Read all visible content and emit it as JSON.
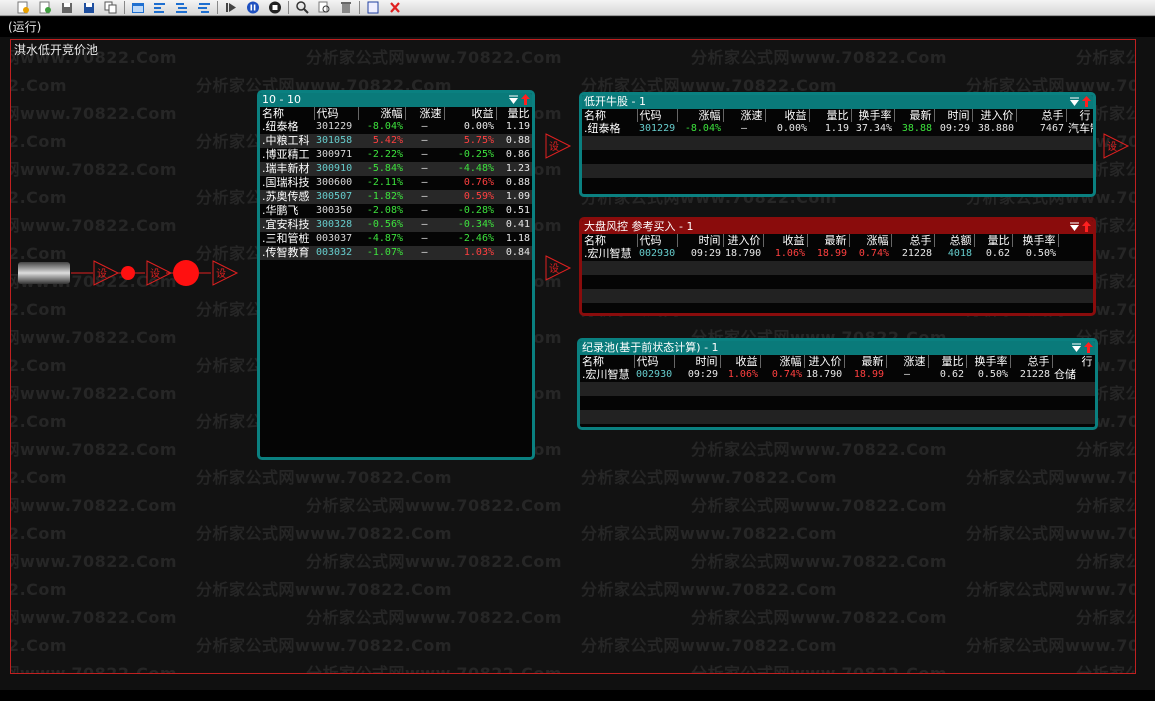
{
  "toolbar": {
    "buttons": [
      "new-icon",
      "open-icon",
      "save-icon",
      "save-as-icon",
      "copy-icon",
      "window-icon",
      "align-left-icon",
      "align-center-icon",
      "align-right-icon",
      "step-icon",
      "pause-icon",
      "stop-icon",
      "search-icon",
      "edit-search-icon",
      "delete-icon",
      "page-icon",
      "close-icon"
    ]
  },
  "run_status": "(运行)",
  "canvas_title": "淇水低开竞价池",
  "watermark": "分析家公式网www.70822.Com",
  "flow": {
    "node_label": "设"
  },
  "panel_main": {
    "title": "10 - 10",
    "columns": [
      "名称",
      "代码",
      "涨幅",
      "涨速",
      "收益",
      "量比"
    ],
    "rows": [
      {
        "name": "纽泰格",
        "code": "301229",
        "change": "-8.04%",
        "speed": "—",
        "profit": "0.00%",
        "ratio": "1.19",
        "codeColor": "w",
        "profitColor": "w"
      },
      {
        "name": "中粮工科",
        "code": "301058",
        "change": "5.42%",
        "speed": "—",
        "profit": "5.75%",
        "ratio": "0.88",
        "codeColor": "cyan",
        "changeColor": "r",
        "profitColor": "r"
      },
      {
        "name": "博亚精工",
        "code": "300971",
        "change": "-2.22%",
        "speed": "—",
        "profit": "-0.25%",
        "ratio": "0.86",
        "codeColor": "w",
        "profitColor": "g"
      },
      {
        "name": "瑞丰新材",
        "code": "300910",
        "change": "-5.84%",
        "speed": "—",
        "profit": "-4.48%",
        "ratio": "1.23",
        "codeColor": "cyan",
        "profitColor": "g"
      },
      {
        "name": "国瑞科技",
        "code": "300600",
        "change": "-2.11%",
        "speed": "—",
        "profit": "0.76%",
        "ratio": "0.88",
        "codeColor": "w",
        "profitColor": "r"
      },
      {
        "name": "苏奥传感",
        "code": "300507",
        "change": "-1.82%",
        "speed": "—",
        "profit": "0.59%",
        "ratio": "1.09",
        "codeColor": "cyan",
        "profitColor": "r"
      },
      {
        "name": "华鹏飞",
        "code": "300350",
        "change": "-2.08%",
        "speed": "—",
        "profit": "-0.28%",
        "ratio": "0.51",
        "codeColor": "w",
        "profitColor": "g"
      },
      {
        "name": "宜安科技",
        "code": "300328",
        "change": "-0.56%",
        "speed": "—",
        "profit": "-0.34%",
        "ratio": "0.41",
        "codeColor": "cyan",
        "profitColor": "g"
      },
      {
        "name": "三和管桩",
        "code": "003037",
        "change": "-4.87%",
        "speed": "—",
        "profit": "-2.46%",
        "ratio": "1.18",
        "codeColor": "w",
        "profitColor": "g"
      },
      {
        "name": "传智教育",
        "code": "003032",
        "change": "-1.07%",
        "speed": "—",
        "profit": "1.03%",
        "ratio": "0.84",
        "codeColor": "cyan",
        "profitColor": "r"
      }
    ]
  },
  "panel_bull": {
    "title": "低开牛股 - 1",
    "columns": [
      "名称",
      "代码",
      "涨幅",
      "涨速",
      "收益",
      "量比",
      "换手率",
      "最新",
      "时间",
      "进入价",
      "总手",
      "行"
    ],
    "row": [
      "纽泰格",
      "301229",
      "-8.04%",
      "—",
      "0.00%",
      "1.19",
      "37.34%",
      "38.88",
      "09:29",
      "38.880",
      "7467",
      "汽车制"
    ]
  },
  "panel_risk": {
    "title": "大盘风控 参考买入 - 1",
    "columns": [
      "名称",
      "代码",
      "时间",
      "进入价",
      "收益",
      "最新",
      "涨幅",
      "总手",
      "总额",
      "量比",
      "换手率"
    ],
    "row": [
      "宏川智慧",
      "002930",
      "09:29",
      "18.790",
      "1.06%",
      "18.99",
      "0.74%",
      "21228",
      "4018",
      "0.62",
      "0.50%"
    ]
  },
  "panel_record": {
    "title": "纪录池(基于前状态计算) - 1",
    "columns": [
      "名称",
      "代码",
      "时间",
      "收益",
      "涨幅",
      "进入价",
      "最新",
      "涨速",
      "量比",
      "换手率",
      "总手",
      "行"
    ],
    "row": [
      "宏川智慧",
      "002930",
      "09:29",
      "1.06%",
      "0.74%",
      "18.790",
      "18.99",
      "—",
      "0.62",
      "0.50%",
      "21228",
      "仓储"
    ]
  },
  "colors": {
    "teal": "#0a8080",
    "darkred": "#8a0c0c",
    "up": "#ff4040",
    "down": "#3de33d"
  }
}
